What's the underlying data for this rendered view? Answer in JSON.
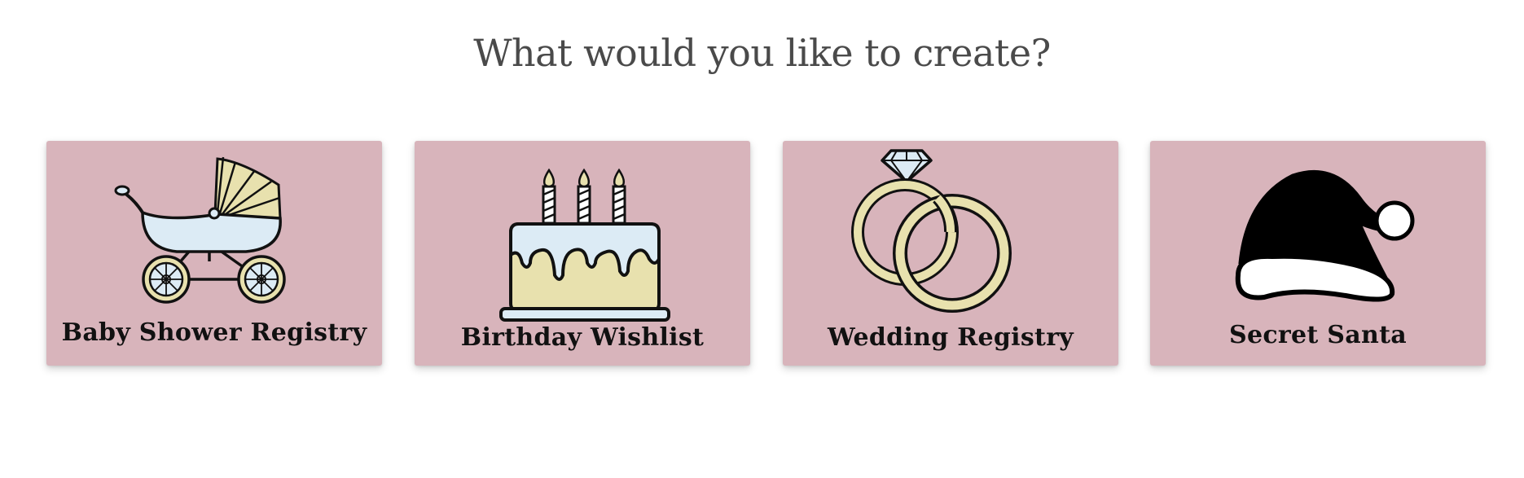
{
  "page": {
    "title": "What would you like to create?"
  },
  "cards": [
    {
      "label": "Baby Shower Registry",
      "icon": "baby-stroller-icon"
    },
    {
      "label": "Birthday Wishlist",
      "icon": "birthday-cake-icon"
    },
    {
      "label": "Wedding Registry",
      "icon": "wedding-rings-icon"
    },
    {
      "label": "Secret Santa",
      "icon": "santa-hat-icon"
    }
  ],
  "colors": {
    "card_background": "#d8b4bb",
    "title_text": "#4a4a4a",
    "label_text": "#111111",
    "icon_cream": "#e8e1ae",
    "icon_pale_blue": "#dcebf5"
  }
}
